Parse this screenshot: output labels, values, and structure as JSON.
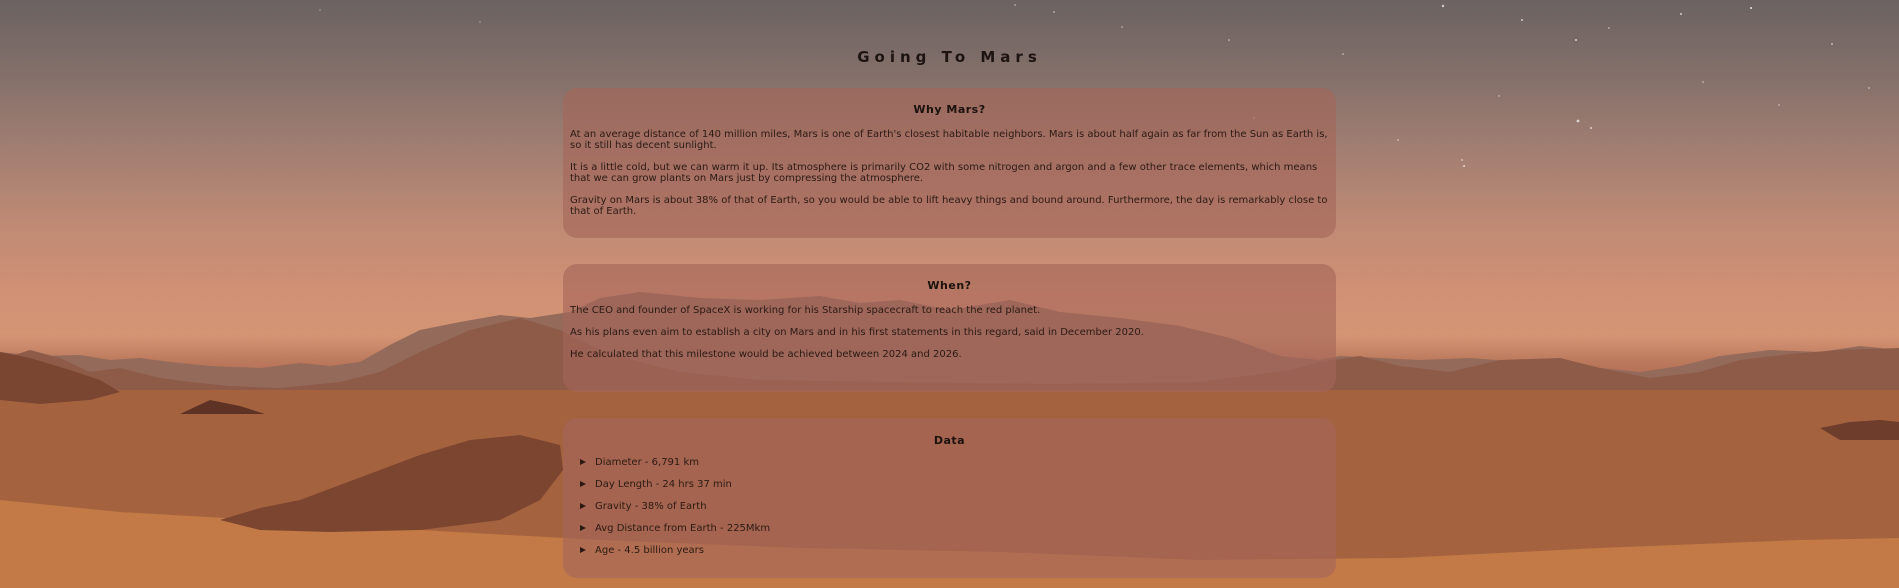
{
  "page": {
    "title": "Going To Mars"
  },
  "sections": {
    "why": {
      "heading": "Why Mars?",
      "paragraphs": [
        "At an average distance of 140 million miles, Mars is one of Earth's closest habitable neighbors. Mars is about half again as far from the Sun as Earth is, so it still has decent sunlight.",
        "It is a little cold, but we can warm it up. Its atmosphere is primarily CO2 with some nitrogen and argon and a few other trace elements, which means that we can grow plants on Mars just by compressing the atmosphere.",
        "Gravity on Mars is about 38% of that of Earth, so you would be able to lift heavy things and bound around. Furthermore, the day is remarkably close to that of Earth."
      ]
    },
    "when": {
      "heading": "When?",
      "paragraphs": [
        "The CEO and founder of SpaceX is working for his Starship spacecraft to reach the red planet.",
        "As his plans even aim to establish a city on Mars and in his first statements in this regard, said in December 2020.",
        "He calculated that this milestone would be achieved between 2024 and 2026."
      ]
    },
    "data": {
      "heading": "Data",
      "items": [
        "Diameter - 6,791 km",
        "Day Length - 24 hrs 37 min",
        "Gravity - 38% of Earth",
        "Avg Distance from Earth - 225Mkm",
        "Age - 4.5 billion years"
      ]
    }
  },
  "colors": {
    "card_background": "#a56658",
    "text": "#2b1a14",
    "sky_top": "#6b6261",
    "horizon": "#d19175",
    "sand": "#b86b40"
  },
  "icons": {
    "list_bullet": "triangle-right-icon"
  }
}
